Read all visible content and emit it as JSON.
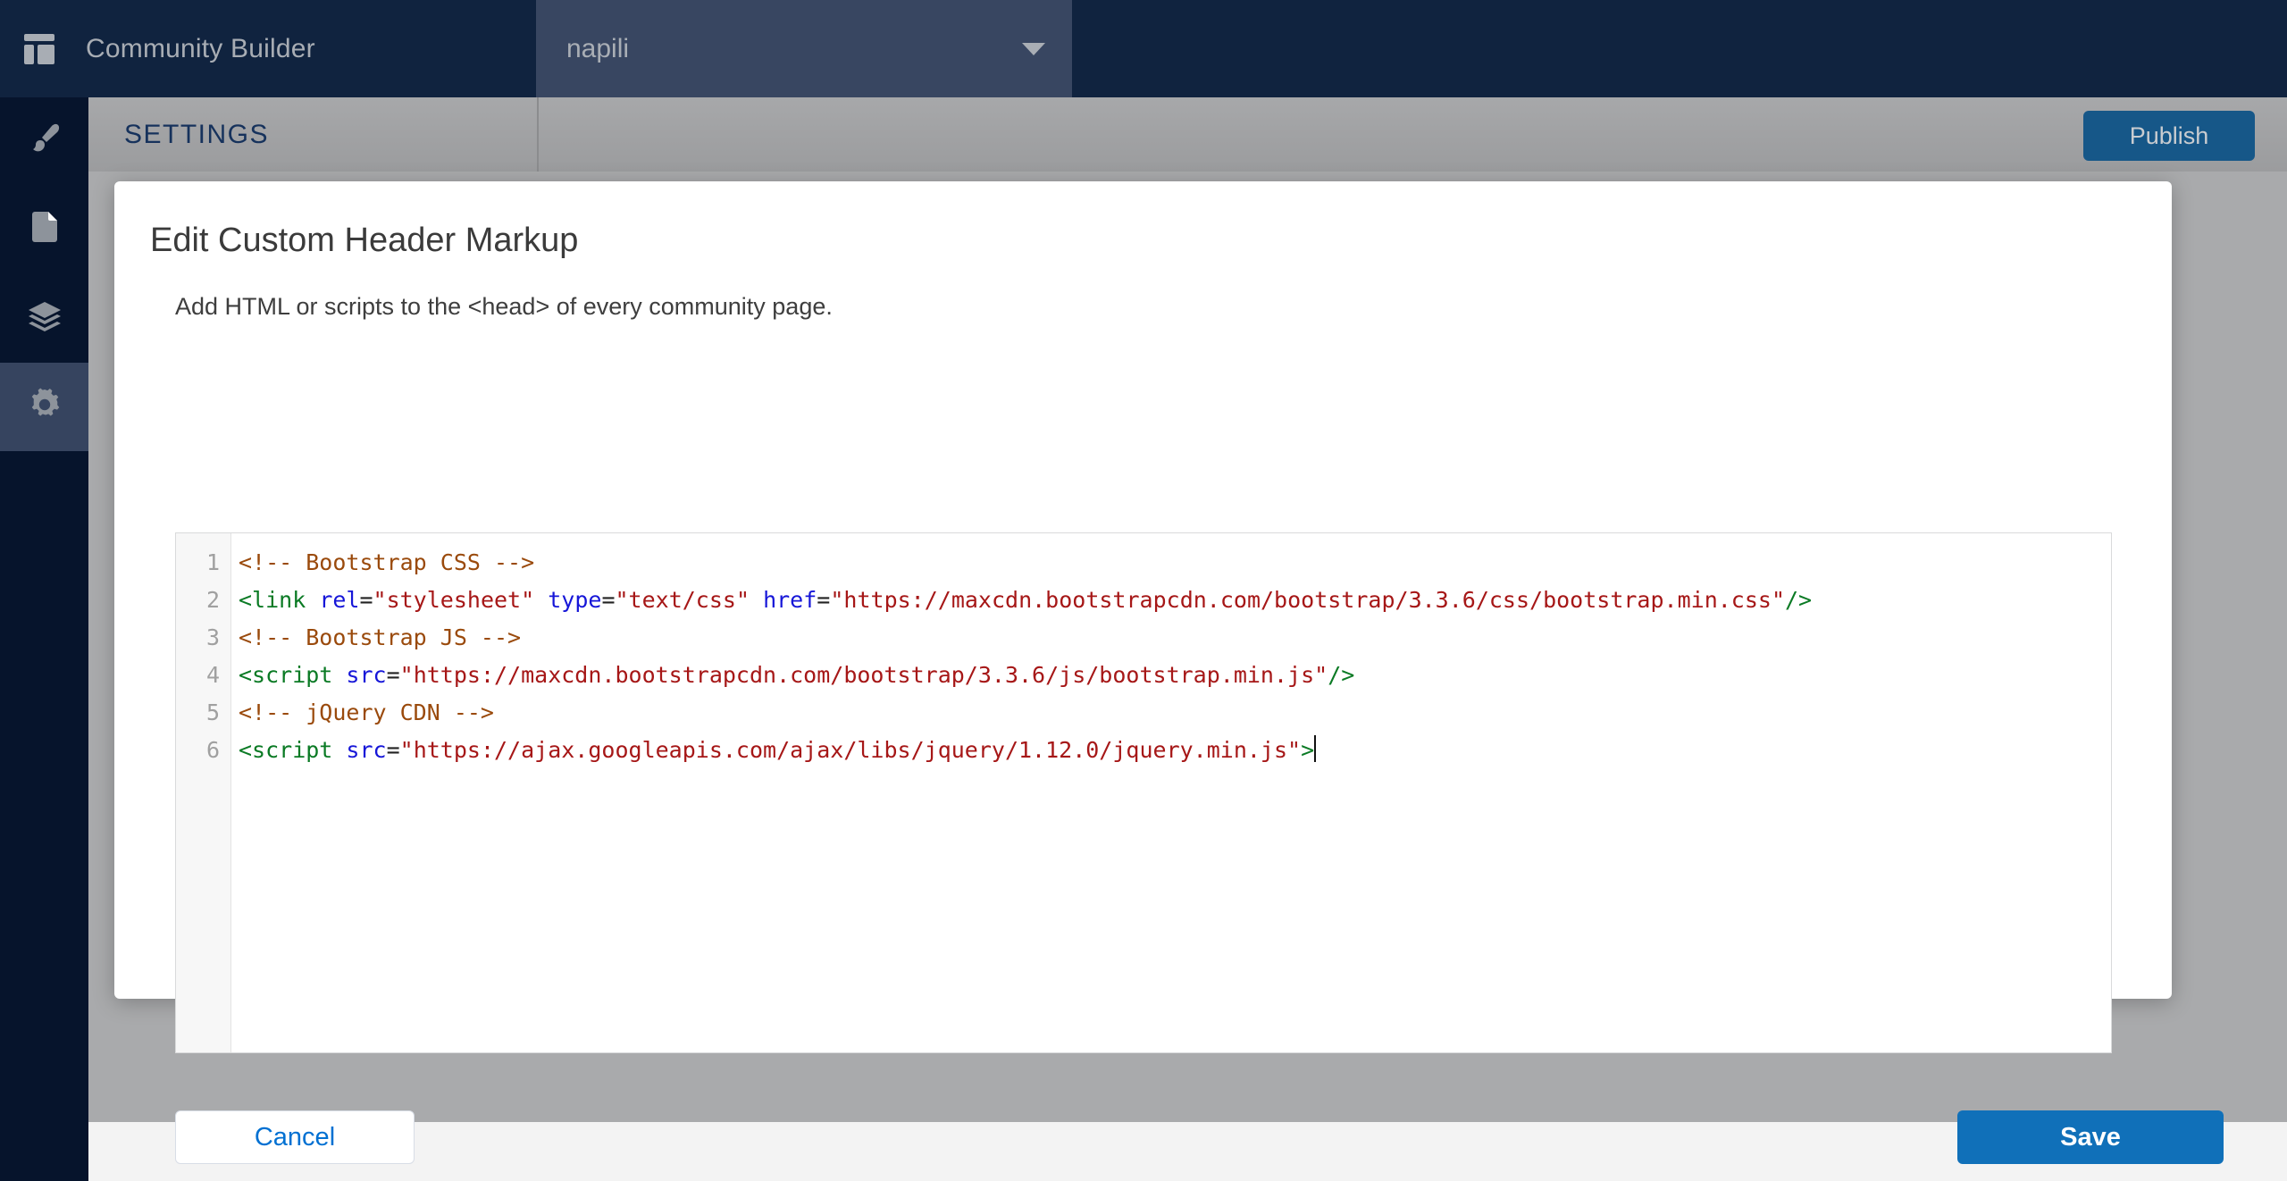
{
  "topbar": {
    "brand_icon": "community-builder-logo-icon",
    "brand_title": "Community Builder",
    "site_selector": {
      "value": "napili",
      "caret_icon": "chevron-down-icon"
    }
  },
  "rail": {
    "items": [
      {
        "icon": "paintbrush-icon",
        "name": "theme",
        "active": false
      },
      {
        "icon": "page-icon",
        "name": "pages",
        "active": false
      },
      {
        "icon": "layers-icon",
        "name": "components",
        "active": false
      },
      {
        "icon": "gear-icon",
        "name": "settings",
        "active": true
      }
    ]
  },
  "settings_bar": {
    "title": "SETTINGS",
    "publish_label": "Publish"
  },
  "modal": {
    "title": "Edit Custom Header Markup",
    "subtitle": "Add HTML or scripts to the <head> of every community page.",
    "cancel_label": "Cancel",
    "save_label": "Save",
    "editor": {
      "line_numbers": [
        "1",
        "2",
        "3",
        "4",
        "5",
        "6"
      ],
      "lines": [
        [
          {
            "t": "comment",
            "v": "<!-- Bootstrap CSS -->"
          }
        ],
        [
          {
            "t": "tag",
            "v": "<link "
          },
          {
            "t": "attr",
            "v": "rel"
          },
          {
            "t": "punct",
            "v": "="
          },
          {
            "t": "str",
            "v": "\"stylesheet\""
          },
          {
            "t": "punct",
            "v": " "
          },
          {
            "t": "attr",
            "v": "type"
          },
          {
            "t": "punct",
            "v": "="
          },
          {
            "t": "str",
            "v": "\"text/css\""
          },
          {
            "t": "punct",
            "v": " "
          },
          {
            "t": "attr",
            "v": "href"
          },
          {
            "t": "punct",
            "v": "="
          },
          {
            "t": "str",
            "v": "\"https://maxcdn.bootstrapcdn.com/bootstrap/3.3.6/css/bootstrap.min.css\""
          },
          {
            "t": "tag",
            "v": "/>"
          }
        ],
        [
          {
            "t": "comment",
            "v": "<!-- Bootstrap JS -->"
          }
        ],
        [
          {
            "t": "tag",
            "v": "<script "
          },
          {
            "t": "attr",
            "v": "src"
          },
          {
            "t": "punct",
            "v": "="
          },
          {
            "t": "str",
            "v": "\"https://maxcdn.bootstrapcdn.com/bootstrap/3.3.6/js/bootstrap.min.js\""
          },
          {
            "t": "tag",
            "v": "/>"
          }
        ],
        [
          {
            "t": "comment",
            "v": "<!-- jQuery CDN -->"
          }
        ],
        [
          {
            "t": "tag",
            "v": "<script "
          },
          {
            "t": "attr",
            "v": "src"
          },
          {
            "t": "punct",
            "v": "="
          },
          {
            "t": "str",
            "v": "\"https://ajax.googleapis.com/ajax/libs/jquery/1.12.0/jquery.min.js\""
          },
          {
            "t": "tag",
            "v": ">"
          }
        ]
      ],
      "cursor_line": 6
    }
  },
  "colors": {
    "topbar_bg": "#10233f",
    "site_select_bg": "#384661",
    "rail_bg": "#06142c",
    "rail_active_bg": "#36445f",
    "settings_text": "#16325c",
    "publish_bg": "#165788",
    "save_bg": "#1070b9",
    "cancel_text": "#0070d2",
    "code_comment": "#9a4a0c",
    "code_tag": "#0a7a24",
    "code_attr": "#1616d8",
    "code_string": "#a61717"
  }
}
